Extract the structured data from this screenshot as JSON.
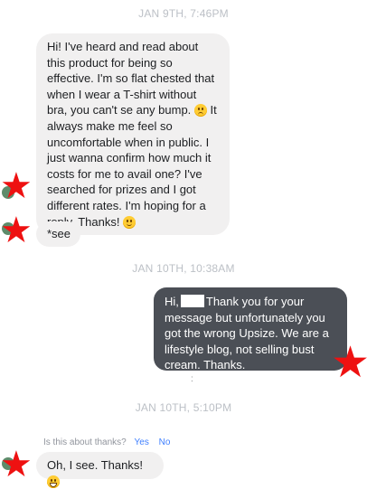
{
  "timestamps": [
    "JAN 9TH, 7:46PM",
    "JAN 10TH, 10:38AM",
    "JAN 10TH, 5:10PM"
  ],
  "messages": {
    "m1_part1": "Hi! I've heard and read about this product for being so effective. I'm so flat chested that when I wear a T-shirt without bra, you can't se any bump.",
    "m1_part2": "It always make me feel so uncomfortable when in public. I just wanna confirm how much it costs for me to avail one? I've searched for prizes and I got different rates. I'm hoping for a reply. Thanks!",
    "m2": "*see",
    "reply_hi": "Hi,",
    "reply_body": "Thank you for your message but unfortunately you got the wrong Upsize. We are a lifestyle blog, not selling bust cream. Thanks.",
    "m3": "Oh, I see. Thanks!"
  },
  "prompt": {
    "question": "Is this about thanks?",
    "yes": "Yes",
    "no": "No"
  },
  "misc": {
    "dot": ":"
  },
  "icons": {
    "sad": "frowning-face-icon",
    "smile": "smiling-face-icon",
    "grin": "grinning-face-icon",
    "star": "red-star-icon"
  },
  "colors": {
    "incoming": "#f1f0f0",
    "outgoing": "#4b4f56",
    "star": "#ee1111",
    "link": "#4080ff"
  }
}
